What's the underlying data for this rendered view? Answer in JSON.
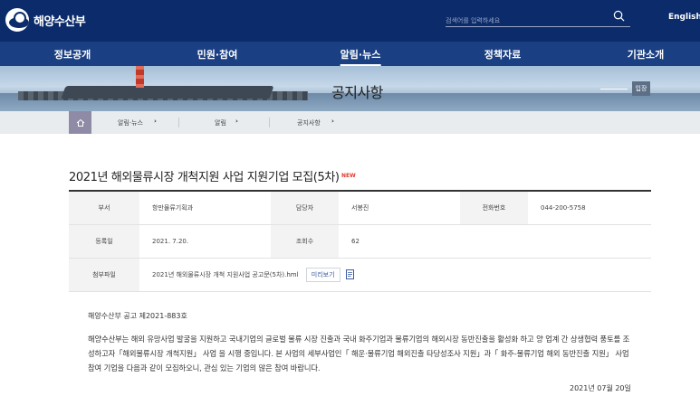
{
  "header": {
    "logo_text": "해양수산부",
    "search_placeholder": "검색어를 입력하세요",
    "lang_label": "English"
  },
  "nav": {
    "items": [
      {
        "label": "정보공개"
      },
      {
        "label": "민원·참여"
      },
      {
        "label": "알림·뉴스",
        "active": true
      },
      {
        "label": "정책자료"
      },
      {
        "label": "기관소개"
      }
    ]
  },
  "banner": {
    "title": "공지사항",
    "button_label": "입장"
  },
  "breadcrumb": {
    "items": [
      "알림·뉴스",
      "알림",
      "공지사항"
    ]
  },
  "post": {
    "title": "2021년 해외물류시장 개척지원 사업 지원기업 모집(5차)",
    "new_badge": "NEW"
  },
  "info": {
    "dept_label": "부서",
    "dept_value": "항만물류기획과",
    "manager_label": "담당자",
    "manager_value": "서봉진",
    "phone_label": "전화번호",
    "phone_value": "044-200-5758",
    "date_label": "등록일",
    "date_value": "2021. 7.20.",
    "views_label": "조회수",
    "views_value": "62",
    "attach_label": "첨부파일",
    "attach_value": "2021년 해외물류시장 개척 지원사업 공고문(5차).hml",
    "preview_label": "미리보기"
  },
  "content": {
    "notice_number": "해양수산부 공고 제2021-883호",
    "body": "해양수산부는 해외 유망사업 발굴을 지원하고 국내기업의 글로벌 물류 시장 진출과 국내 화주기업과 물류기업의 해외시장 동반진출을 활성화 하고 양 업계 간 상생협력 풍토를 조성하고자「해외물류시장 개척지원」 사업 을 시행 중입니다. 본 사업의 세부사업인「 해운·물류기업 해외진출 타당성조사 지원」과「 화주-물류기업 해외 동반진출 지원」 사업 참여 기업을 다음과 같이 모집하오니, 관심 있는 기업의 많은 참여 바랍니다.",
    "date": "2021년 07월 20일"
  }
}
